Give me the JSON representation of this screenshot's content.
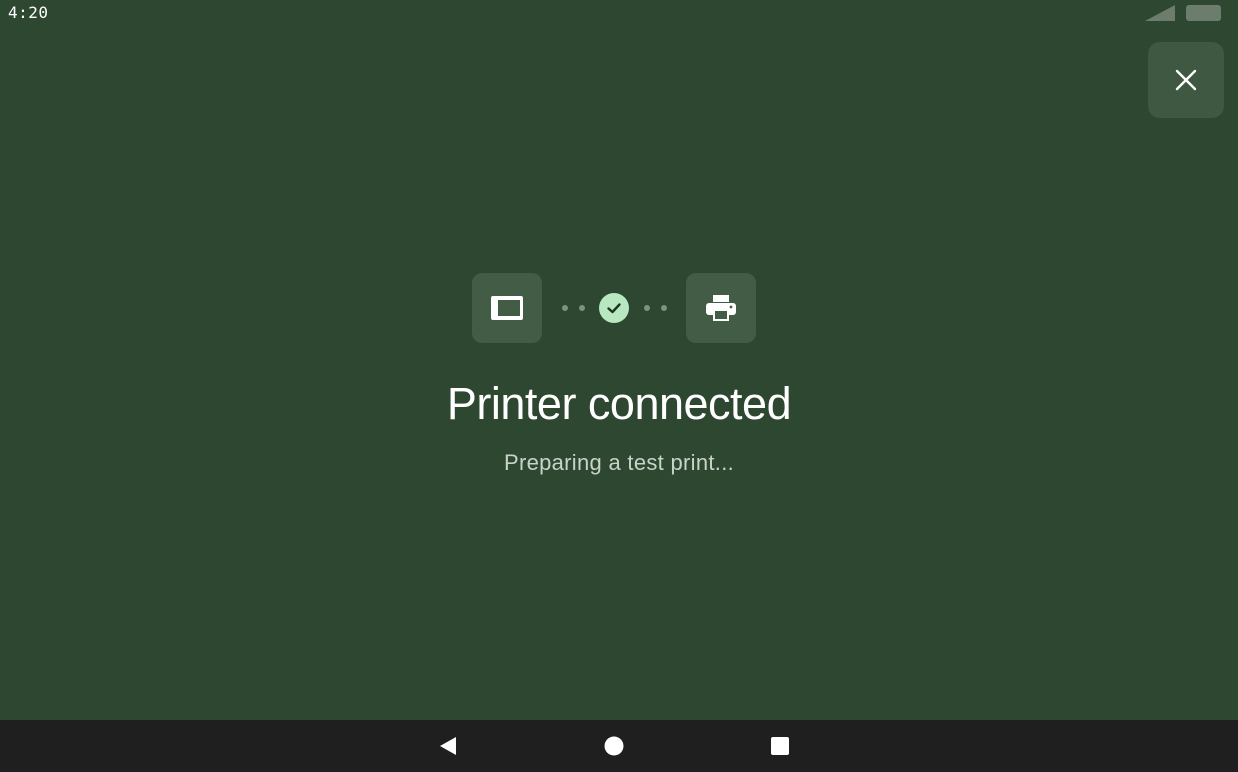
{
  "status_bar": {
    "time": "4:20",
    "signal_icon": "cell-signal-icon",
    "battery_icon": "battery-icon"
  },
  "close_button": {
    "icon": "close-icon"
  },
  "connection": {
    "source_icon": "tablet-icon",
    "status_icon": "check-icon",
    "target_icon": "printer-icon",
    "status_color": "#b8e8bf"
  },
  "content": {
    "title": "Printer connected",
    "subtitle": "Preparing a test print..."
  },
  "nav_bar": {
    "back_icon": "back-icon",
    "home_icon": "home-icon",
    "recents_icon": "recents-icon"
  },
  "colors": {
    "background": "#2d4730",
    "tile": "#435c46",
    "nav_bar": "#1f1f1f"
  }
}
